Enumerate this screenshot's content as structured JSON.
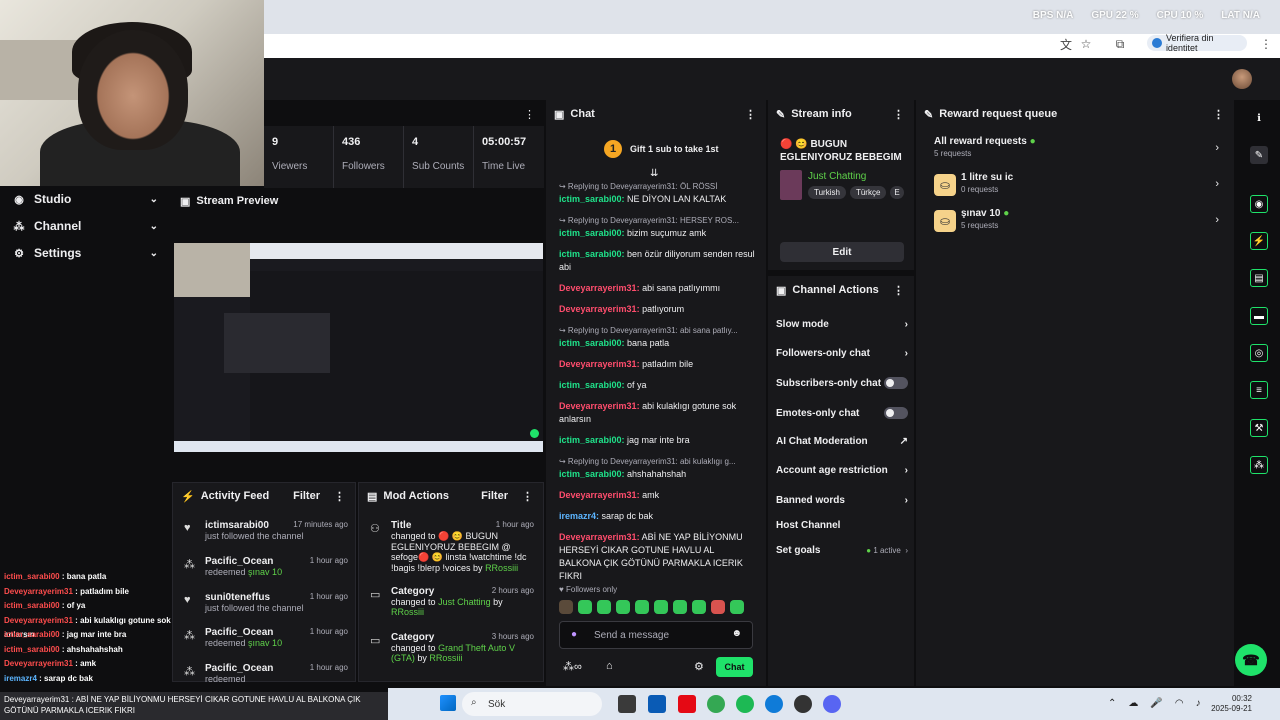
{
  "browser": {
    "stats": [
      "BPS N/A",
      "GPU 22 %",
      "CPU 10 %",
      "LAT N/A"
    ],
    "verify_label": "Verifiera din identitet"
  },
  "nav": {
    "items": [
      {
        "label": "Studio",
        "icon": "studio-icon"
      },
      {
        "label": "Channel",
        "icon": "channel-icon"
      },
      {
        "label": "Settings",
        "icon": "gear-icon"
      }
    ]
  },
  "stats": [
    {
      "value": "9",
      "label": "Viewers"
    },
    {
      "value": "436",
      "label": "Followers"
    },
    {
      "value": "4",
      "label": "Sub Counts"
    },
    {
      "value": "05:00:57",
      "label": "Time Live"
    }
  ],
  "preview": {
    "title": "Stream Preview"
  },
  "activity": {
    "title": "Activity Feed",
    "filter": "Filter",
    "rows": [
      {
        "name": "ictimsarabi00",
        "time": "17 minutes ago",
        "text": "just followed the channel",
        "icon": "heart-icon"
      },
      {
        "name": "Pacific_Ocean",
        "time": "1 hour ago",
        "text": "redeemed",
        "extra": "şınav 10",
        "icon": "points-icon"
      },
      {
        "name": "suni0teneffus",
        "time": "1 hour ago",
        "text": "just followed the channel",
        "icon": "heart-icon"
      },
      {
        "name": "Pacific_Ocean",
        "time": "1 hour ago",
        "text": "redeemed",
        "extra": "şınav 10",
        "icon": "points-icon"
      },
      {
        "name": "Pacific_Ocean",
        "time": "1 hour ago",
        "text": "redeemed",
        "extra": "",
        "icon": "points-icon"
      }
    ]
  },
  "mod": {
    "title": "Mod Actions",
    "filter": "Filter",
    "rows": [
      {
        "name": "Title",
        "time": "1 hour ago",
        "text": "changed to 🔴 😊 BUGUN EGLENIYORUZ BEBEGIM @ sefoge🔴 😊 linsta !watchtime !dc !bagis !blerp !voices by",
        "by": "RRossiii"
      },
      {
        "name": "Category",
        "time": "2 hours ago",
        "text": "changed to",
        "value": "Just Chatting",
        "by": "RRossiii"
      },
      {
        "name": "Category",
        "time": "3 hours ago",
        "text": "changed to",
        "value": "Grand Theft Auto V (GTA)",
        "by": "RRossiii"
      }
    ]
  },
  "chat": {
    "title": "Chat",
    "gift_label": "Gift 1 sub to take 1st",
    "gift_num": "1",
    "followers_only": "Followers only",
    "placeholder": "Send a message",
    "send": "Chat"
  },
  "overlay": [
    {
      "user": "ictim_sarabi00",
      "msg": "bana patla",
      "red": false
    },
    {
      "user": "Deveyarrayerim31",
      "msg": "patladım bile",
      "red": true
    },
    {
      "user": "ictim_sarabi00",
      "msg": "of ya",
      "red": false
    },
    {
      "user": "Deveyarrayerim31",
      "msg": "abi kulaklıgı gotune sok anlarsın",
      "red": true
    },
    {
      "user": "ictim_sarabi00",
      "msg": "jag mar inte bra",
      "red": false
    },
    {
      "user": "ictim_sarabi00",
      "msg": "ahshahahshah",
      "red": false
    },
    {
      "user": "Deveyarrayerim31",
      "msg": "amk",
      "red": true
    },
    {
      "user": "iremazr4",
      "msg": "sarap dc bak",
      "red": false
    }
  ],
  "overlay_banner": "Deveyarrayerim31 : ABİ NE YAP BİLİYONMU HERSEYİ CIKAR GOTUNE HAVLU AL BALKONA ÇIK GÖTÜNÜ PARMAKLA ICERIK FIKRI",
  "stream_info": {
    "title": "Stream info",
    "stream_title": "🔴 😊 BUGUN EGLENIYORUZ BEBEGIM ...",
    "category": "Just Chatting",
    "tags": [
      "Turkish",
      "Türkçe",
      "E"
    ],
    "edit": "Edit"
  },
  "channel_actions": {
    "title": "Channel Actions",
    "items": [
      {
        "label": "Slow mode",
        "kind": "chevron"
      },
      {
        "label": "Followers-only chat",
        "kind": "chevron"
      },
      {
        "label": "Subscribers-only chat",
        "kind": "toggle"
      },
      {
        "label": "Emotes-only chat",
        "kind": "toggle"
      },
      {
        "label": "AI Chat Moderation",
        "kind": "external"
      },
      {
        "label": "Account age restriction",
        "kind": "chevron"
      },
      {
        "label": "Banned words",
        "kind": "chevron"
      },
      {
        "label": "Host Channel",
        "kind": "none"
      },
      {
        "label": "Set goals",
        "kind": "chevron",
        "badge": "1 active"
      }
    ]
  },
  "rewards": {
    "title": "Reward request queue",
    "all_label": "All reward requests",
    "all_count": "5 requests",
    "items": [
      {
        "label": "1 litre su ic",
        "count": "0 requests",
        "dot": false
      },
      {
        "label": "şınav 10",
        "count": "5 requests",
        "dot": true
      }
    ]
  },
  "taskbar": {
    "search": "Sök",
    "time": "00:32",
    "date": "2025-09-21"
  },
  "colors": {
    "accent": "#1fe26a",
    "bg": "#0e0e10",
    "panel": "#18181b"
  }
}
